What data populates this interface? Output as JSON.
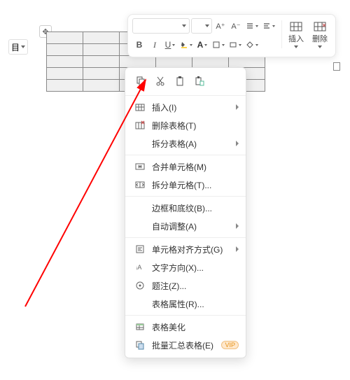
{
  "page": {
    "indicator": "目"
  },
  "toolbar": {
    "font_name": "",
    "font_size": "",
    "inc_font": "A⁺",
    "dec_font": "A⁻",
    "bold": "B",
    "italic": "I",
    "underline": "U",
    "strike": "A",
    "insert_label": "插入",
    "delete_label": "删除"
  },
  "context_menu": {
    "icons": [
      "copy",
      "cut",
      "paste",
      "paste-special"
    ],
    "items": [
      {
        "id": "insert",
        "label": "插入(I)",
        "icon": "insert",
        "submenu": true
      },
      {
        "id": "delete-table",
        "label": "删除表格(T)",
        "icon": "delete-table",
        "submenu": false
      },
      {
        "id": "split-table",
        "label": "拆分表格(A)",
        "icon": "",
        "submenu": true
      },
      {
        "id": "merge-cells",
        "label": "合并单元格(M)",
        "icon": "merge",
        "submenu": false
      },
      {
        "id": "split-cells",
        "label": "拆分单元格(T)...",
        "icon": "split",
        "submenu": false
      },
      {
        "id": "borders",
        "label": "边框和底纹(B)...",
        "icon": "",
        "submenu": false
      },
      {
        "id": "autofit",
        "label": "自动调整(A)",
        "icon": "",
        "submenu": true
      },
      {
        "id": "align",
        "label": "单元格对齐方式(G)",
        "icon": "align",
        "submenu": true
      },
      {
        "id": "text-direction",
        "label": "文字方向(X)...",
        "icon": "text-dir",
        "submenu": false
      },
      {
        "id": "caption",
        "label": "题注(Z)...",
        "icon": "caption",
        "submenu": false
      },
      {
        "id": "properties",
        "label": "表格属性(R)...",
        "icon": "",
        "submenu": false
      },
      {
        "id": "beautify",
        "label": "表格美化",
        "icon": "beautify",
        "submenu": false
      },
      {
        "id": "summary",
        "label": "批量汇总表格(E)",
        "icon": "summary",
        "submenu": false,
        "vip": "VIP"
      }
    ]
  },
  "annotation": {
    "arrow_color": "#ff0000"
  }
}
